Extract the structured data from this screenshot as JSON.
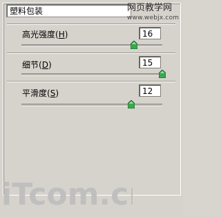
{
  "dialog": {
    "filter_name": "塑料包装",
    "watermark_cn": "网页教学网",
    "watermark_url": "www.webjx.com"
  },
  "controls": [
    {
      "label": "高光强度",
      "shortcut": "H",
      "value": "16",
      "level_fraction": 0.8
    },
    {
      "label": "细节",
      "shortcut": "D",
      "value": "15",
      "level_fraction": 1.0
    },
    {
      "label": "平滑度",
      "shortcut": "S",
      "value": "12",
      "level_fraction": 0.78
    }
  ],
  "logo": {
    "text": "iTcom.cn"
  },
  "colors": {
    "panel": "#d6d3cd",
    "thumb_green": "#39b054"
  }
}
